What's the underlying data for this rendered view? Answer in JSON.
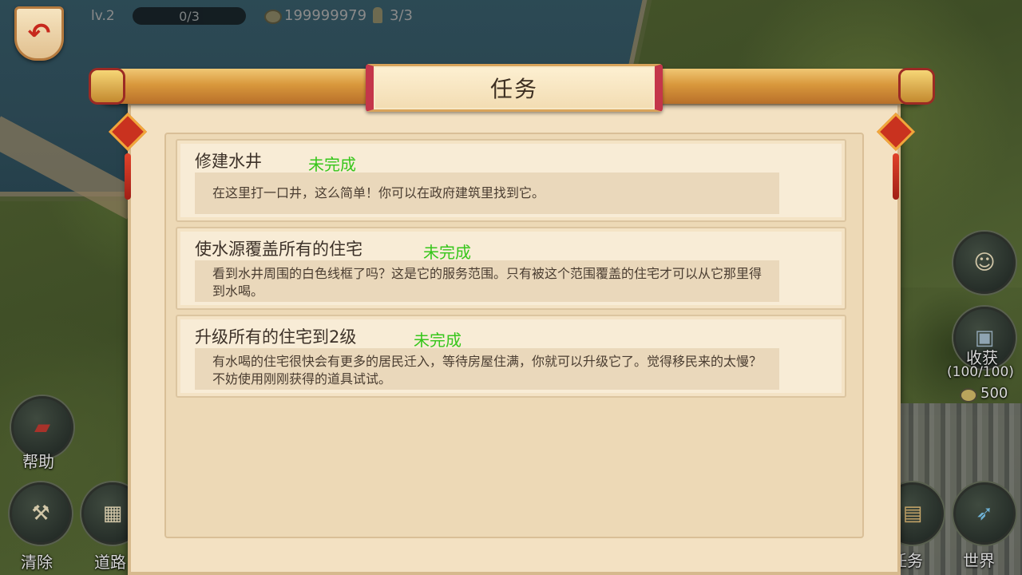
{
  "hud": {
    "level": "lv.2",
    "progress": "0/3",
    "gold": "199999979",
    "population": "3/3"
  },
  "panel": {
    "title": "任务",
    "tasks": [
      {
        "title": "修建水井",
        "status": "未完成",
        "description": "在这里打一口井，这么简单！你可以在政府建筑里找到它。"
      },
      {
        "title": "使水源覆盖所有的住宅",
        "status": "未完成",
        "description": "看到水井周围的白色线框了吗？这是它的服务范围。只有被这个范围覆盖的住宅才可以从它那里得到水喝。"
      },
      {
        "title": "升级所有的住宅到2级",
        "status": "未完成",
        "description": "有水喝的住宅很快会有更多的居民迁入，等待房屋住满，你就可以升级它了。觉得移民来的太慢？不妨使用刚刚获得的道具试试。"
      }
    ]
  },
  "left_buttons": {
    "help": "帮助",
    "clear": "清除",
    "road": "道路"
  },
  "right_buttons": {
    "harvest": "收获",
    "harvest_count": "(100/100)",
    "harvest_gold": "500",
    "tasks": "任务",
    "world": "世界"
  },
  "colors": {
    "status_incomplete": "#36c61b",
    "scroll_rod": "#d9983c",
    "panel_bg": "#f3e1c2",
    "accent_red": "#c4364a"
  },
  "icons": {
    "back": "back-arrow-icon",
    "help": "book-icon",
    "clear": "shovel-icon",
    "road": "road-icon",
    "harvest": "crate-icon",
    "tasks": "map-scroll-icon",
    "world": "telescope-icon",
    "gold": "coin-icon",
    "population": "person-icon"
  }
}
